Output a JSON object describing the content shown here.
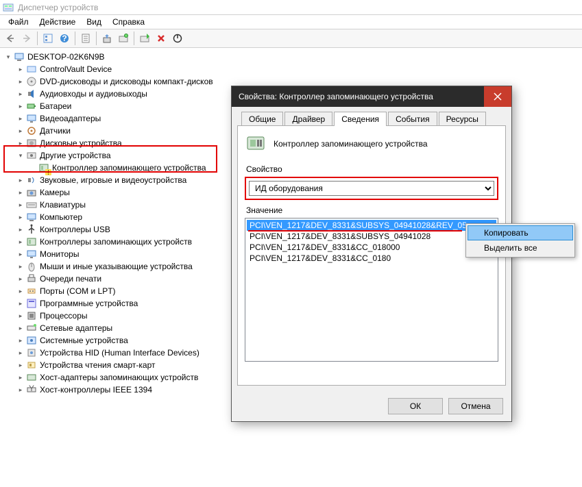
{
  "window": {
    "title": "Диспетчер устройств"
  },
  "menu": {
    "file": "Файл",
    "action": "Действие",
    "view": "Вид",
    "help": "Справка"
  },
  "tree": {
    "root": "DESKTOP-02K6N9B",
    "items": [
      "ControlVault Device",
      "DVD-дисководы и дисководы компакт-дисков",
      "Аудиовходы и аудиовыходы",
      "Батареи",
      "Видеоадаптеры",
      "Датчики",
      "Дисковые устройства",
      "Другие устройства",
      "Звуковые, игровые и видеоустройства",
      "Камеры",
      "Клавиатуры",
      "Компьютер",
      "Контроллеры USB",
      "Контроллеры запоминающих устройств",
      "Мониторы",
      "Мыши и иные указывающие устройства",
      "Очереди печати",
      "Порты (COM и LPT)",
      "Программные устройства",
      "Процессоры",
      "Сетевые адаптеры",
      "Системные устройства",
      "Устройства HID (Human Interface Devices)",
      "Устройства чтения смарт-карт",
      "Хост-адаптеры запоминающих устройств",
      "Хост-контроллеры IEEE 1394"
    ],
    "other_child": "Контроллер запоминающего устройства"
  },
  "dialog": {
    "title": "Свойства: Контроллер запоминающего устройства",
    "tabs": {
      "general": "Общие",
      "driver": "Драйвер",
      "details": "Сведения",
      "events": "События",
      "resources": "Ресурсы"
    },
    "device_name": "Контроллер запоминающего устройства",
    "property_label": "Свойство",
    "property_selected": "ИД оборудования",
    "value_label": "Значение",
    "values": [
      "PCI\\VEN_1217&DEV_8331&SUBSYS_04941028&REV_05",
      "PCI\\VEN_1217&DEV_8331&SUBSYS_04941028",
      "PCI\\VEN_1217&DEV_8331&CC_018000",
      "PCI\\VEN_1217&DEV_8331&CC_0180"
    ],
    "ok": "ОК",
    "cancel": "Отмена"
  },
  "context_menu": {
    "copy": "Копировать",
    "select_all": "Выделить все"
  }
}
